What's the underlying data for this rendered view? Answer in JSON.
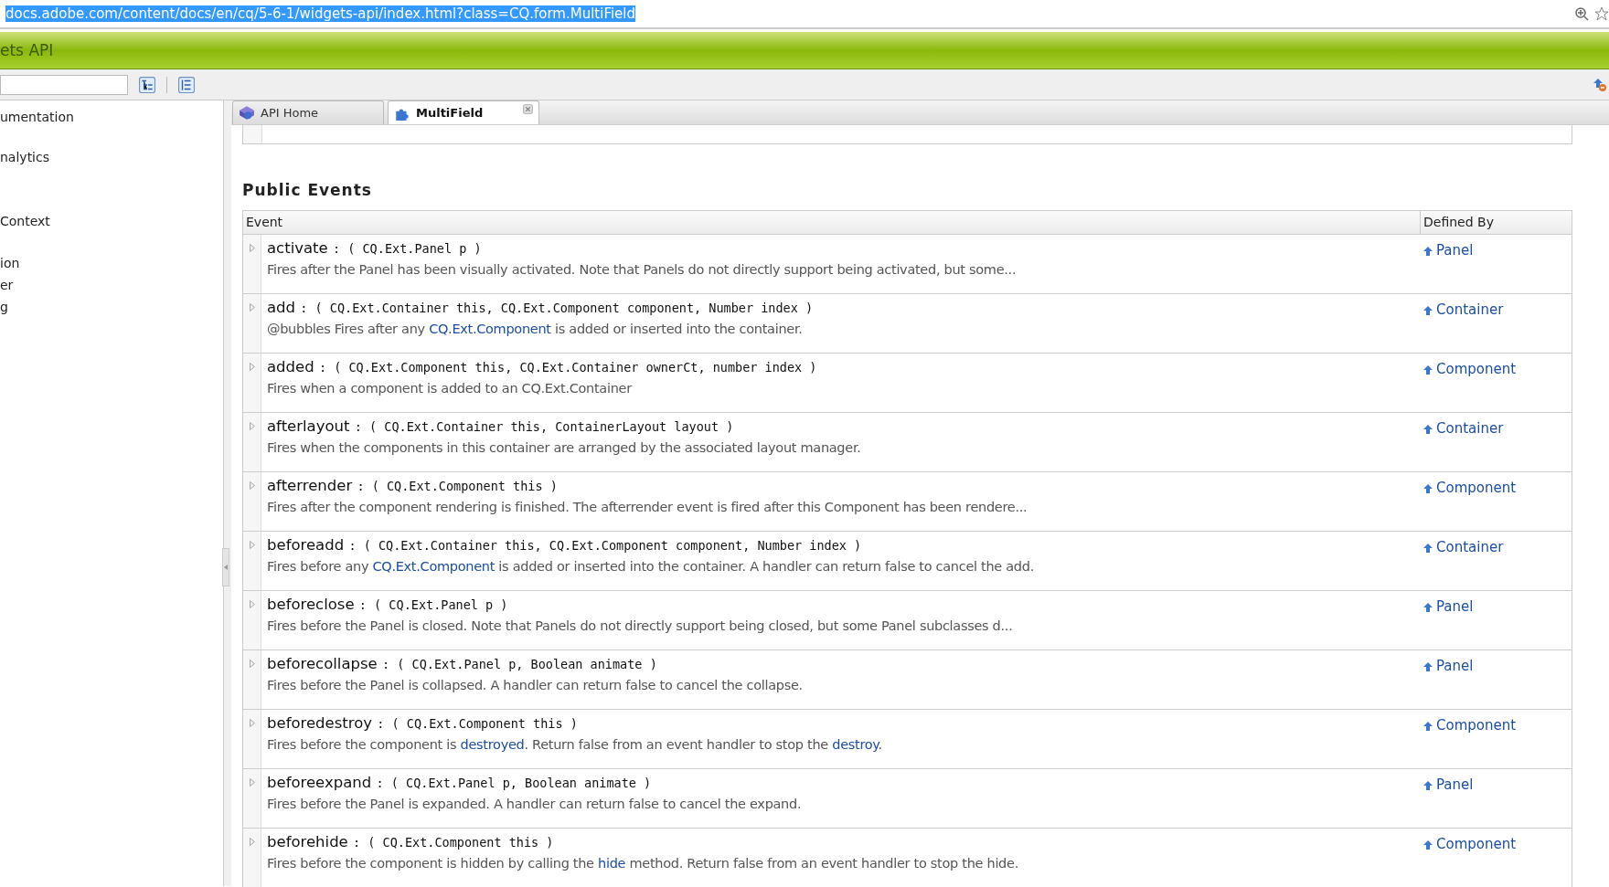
{
  "address_bar": {
    "url": "docs.adobe.com/content/docs/en/cq/5-6-1/widgets-api/index.html?class=CQ.form.MultiField"
  },
  "header": {
    "title": "ets API"
  },
  "sidebar": {
    "items": [
      {
        "label": "umentation"
      },
      {
        "label": "nalytics"
      },
      {
        "label": "Context"
      },
      {
        "label": "ion"
      },
      {
        "label": "er"
      },
      {
        "label": "g"
      }
    ]
  },
  "tabs": [
    {
      "label": "API Home",
      "selected": false,
      "closable": false
    },
    {
      "label": "MultiField",
      "selected": true,
      "closable": true
    }
  ],
  "section_title": "Public Events",
  "table": {
    "columns": [
      "Event",
      "Defined By"
    ],
    "rows": [
      {
        "name": "activate",
        "signature": ": ( CQ.Ext.Panel p )",
        "description": [
          {
            "text": "Fires after the Panel has been visually activated. Note that Panels do not directly support being activated, but some...",
            "link": false
          }
        ],
        "defined_by": "Panel"
      },
      {
        "name": "add",
        "signature": ": ( CQ.Ext.Container this, CQ.Ext.Component component, Number index )",
        "description": [
          {
            "text": "@bubbles Fires after any ",
            "link": false
          },
          {
            "text": "CQ.Ext.Component",
            "link": true
          },
          {
            "text": " is added or inserted into the container.",
            "link": false
          }
        ],
        "defined_by": "Container"
      },
      {
        "name": "added",
        "signature": ": ( CQ.Ext.Component this, CQ.Ext.Container ownerCt, number index )",
        "description": [
          {
            "text": "Fires when a component is added to an CQ.Ext.Container",
            "link": false
          }
        ],
        "defined_by": "Component"
      },
      {
        "name": "afterlayout",
        "signature": ": ( CQ.Ext.Container this, ContainerLayout layout )",
        "description": [
          {
            "text": "Fires when the components in this container are arranged by the associated layout manager.",
            "link": false
          }
        ],
        "defined_by": "Container"
      },
      {
        "name": "afterrender",
        "signature": ": ( CQ.Ext.Component this )",
        "description": [
          {
            "text": "Fires after the component rendering is finished. The afterrender event is fired after this Component has been rendere...",
            "link": false
          }
        ],
        "defined_by": "Component"
      },
      {
        "name": "beforeadd",
        "signature": ": ( CQ.Ext.Container this, CQ.Ext.Component component, Number index )",
        "description": [
          {
            "text": "Fires before any ",
            "link": false
          },
          {
            "text": "CQ.Ext.Component",
            "link": true
          },
          {
            "text": " is added or inserted into the container. A handler can return false to cancel the add.",
            "link": false
          }
        ],
        "defined_by": "Container"
      },
      {
        "name": "beforeclose",
        "signature": ": ( CQ.Ext.Panel p )",
        "description": [
          {
            "text": "Fires before the Panel is closed. Note that Panels do not directly support being closed, but some Panel subclasses d...",
            "link": false
          }
        ],
        "defined_by": "Panel"
      },
      {
        "name": "beforecollapse",
        "signature": ": ( CQ.Ext.Panel p, Boolean animate )",
        "description": [
          {
            "text": "Fires before the Panel is collapsed. A handler can return false to cancel the collapse.",
            "link": false
          }
        ],
        "defined_by": "Panel"
      },
      {
        "name": "beforedestroy",
        "signature": ": ( CQ.Ext.Component this )",
        "description": [
          {
            "text": "Fires before the component is ",
            "link": false
          },
          {
            "text": "destroyed",
            "link": true
          },
          {
            "text": ". Return false from an event handler to stop the ",
            "link": false
          },
          {
            "text": "destroy",
            "link": true
          },
          {
            "text": ".",
            "link": false
          }
        ],
        "defined_by": "Component"
      },
      {
        "name": "beforeexpand",
        "signature": ": ( CQ.Ext.Panel p, Boolean animate )",
        "description": [
          {
            "text": "Fires before the Panel is expanded. A handler can return false to cancel the expand.",
            "link": false
          }
        ],
        "defined_by": "Panel"
      },
      {
        "name": "beforehide",
        "signature": ": ( CQ.Ext.Component this )",
        "description": [
          {
            "text": "Fires before the component is hidden by calling the ",
            "link": false
          },
          {
            "text": "hide",
            "link": true
          },
          {
            "text": " method. Return false from an event handler to stop the hide.",
            "link": false
          }
        ],
        "defined_by": "Component"
      }
    ]
  }
}
